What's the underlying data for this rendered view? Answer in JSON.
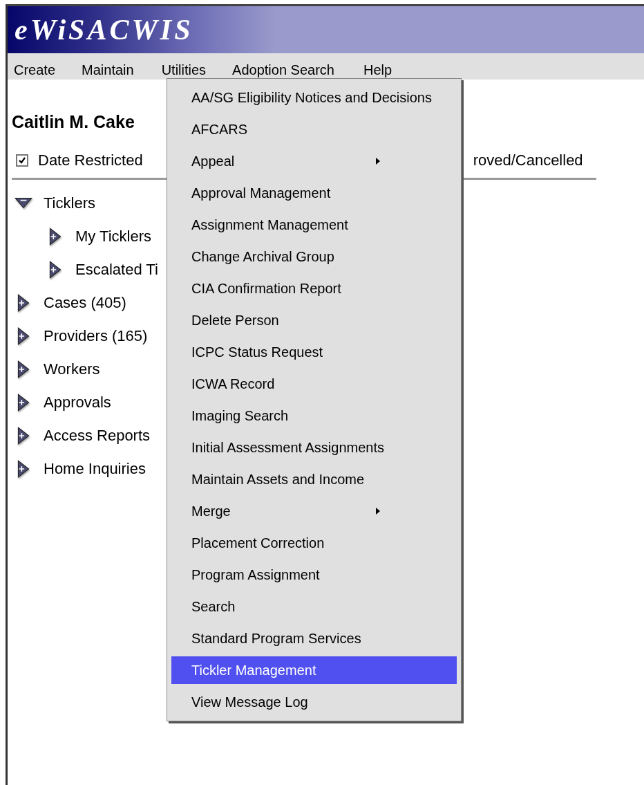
{
  "app_title": "eWiSACWIS",
  "menubar": [
    {
      "label": "Create"
    },
    {
      "label": "Maintain"
    },
    {
      "label": "Utilities"
    },
    {
      "label": "Adoption Search"
    },
    {
      "label": "Help"
    }
  ],
  "worker_name": "Caitlin M. Cake",
  "filters": [
    {
      "label": "Date Restricted",
      "checked": true
    }
  ],
  "filter_tail": "roved/Cancelled",
  "tree": [
    {
      "label": "Ticklers",
      "expanded": true,
      "children": [
        {
          "label": "My Ticklers",
          "expanded": false
        },
        {
          "label": "Escalated Ti",
          "expanded": false
        }
      ]
    },
    {
      "label": "Cases (405)",
      "expanded": false
    },
    {
      "label": "Providers (165)",
      "expanded": false
    },
    {
      "label": "Workers",
      "expanded": false
    },
    {
      "label": "Approvals",
      "expanded": false
    },
    {
      "label": "Access Reports",
      "expanded": false
    },
    {
      "label": "Home Inquiries",
      "expanded": false
    }
  ],
  "utilities_menu": [
    {
      "label": "AA/SG Eligibility Notices and Decisions",
      "submenu": false,
      "selected": false
    },
    {
      "label": "AFCARS",
      "submenu": false,
      "selected": false
    },
    {
      "label": "Appeal",
      "submenu": true,
      "selected": false
    },
    {
      "label": "Approval Management",
      "submenu": false,
      "selected": false
    },
    {
      "label": "Assignment Management",
      "submenu": false,
      "selected": false
    },
    {
      "label": "Change Archival Group",
      "submenu": false,
      "selected": false
    },
    {
      "label": "CIA Confirmation Report",
      "submenu": false,
      "selected": false
    },
    {
      "label": "Delete Person",
      "submenu": false,
      "selected": false
    },
    {
      "label": "ICPC Status Request",
      "submenu": false,
      "selected": false
    },
    {
      "label": "ICWA Record",
      "submenu": false,
      "selected": false
    },
    {
      "label": "Imaging Search",
      "submenu": false,
      "selected": false
    },
    {
      "label": "Initial Assessment Assignments",
      "submenu": false,
      "selected": false
    },
    {
      "label": "Maintain Assets and Income",
      "submenu": false,
      "selected": false
    },
    {
      "label": "Merge",
      "submenu": true,
      "selected": false
    },
    {
      "label": "Placement Correction",
      "submenu": false,
      "selected": false
    },
    {
      "label": "Program Assignment",
      "submenu": false,
      "selected": false
    },
    {
      "label": "Search",
      "submenu": false,
      "selected": false
    },
    {
      "label": "Standard Program Services",
      "submenu": false,
      "selected": false
    },
    {
      "label": "Tickler Management",
      "submenu": false,
      "selected": true
    },
    {
      "label": "View Message Log",
      "submenu": false,
      "selected": false
    }
  ]
}
